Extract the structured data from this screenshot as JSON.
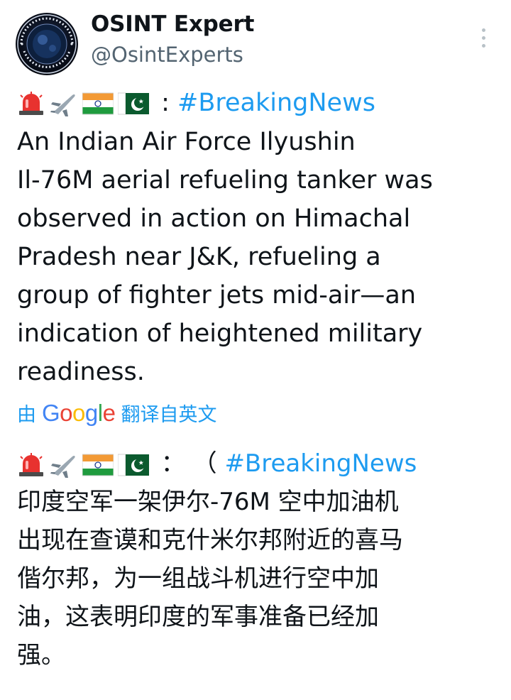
{
  "author": {
    "display_name": "OSINT Expert",
    "handle": "@OsintExperts",
    "avatar_text": "OPEN SOURCE INTELLIGENCE · OSINT EXPERT"
  },
  "icons": {
    "more": "more-vertical-icon",
    "siren": "police-light-emoji",
    "airplane": "airplane-emoji",
    "flag_india": "india-flag-emoji",
    "flag_pakistan": "pakistan-flag-emoji"
  },
  "tweet": {
    "original": {
      "prefix": " : ",
      "hashtag": "#BreakingNews",
      "lines": [
        "An Indian Air Force Ilyushin",
        "Il-76M  aerial refueling tanker was",
        "observed in action on Himachal",
        "Pradesh near J&K, refueling a",
        "group of fighter jets mid-air—an",
        "indication of heightened military",
        "readiness."
      ]
    },
    "translation_note": {
      "prefix": "由",
      "brand": "Google",
      "suffix": "翻译自英文"
    },
    "translated": {
      "prefix": " ： （ ",
      "hashtag": "#BreakingNews",
      "lines": [
        "印度空军一架伊尔-76M 空中加油机",
        "出现在查谟和克什米尔邦附近的喜马",
        "偕尔邦，为一组战斗机进行空中加",
        "油，这表明印度的军事准备已经加",
        "强。"
      ]
    }
  },
  "colors": {
    "link": "#1d9bf0",
    "text": "#0f1419",
    "secondary": "#536471",
    "google_blue": "#4285F4",
    "google_red": "#EA4335",
    "google_yellow": "#FBBC05",
    "google_green": "#34A853"
  }
}
